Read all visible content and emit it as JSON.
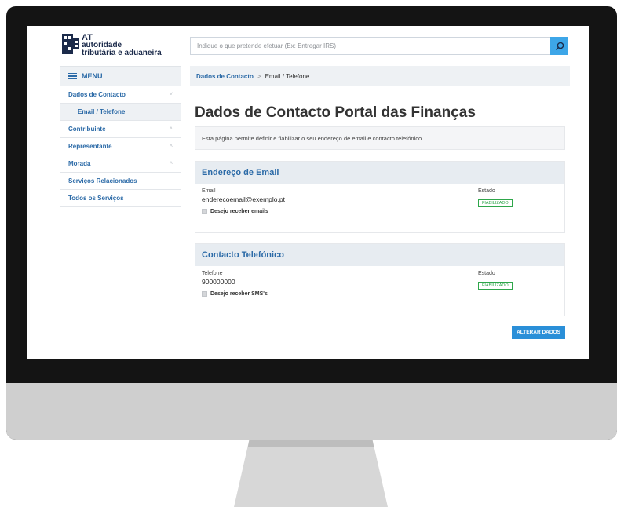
{
  "logo": {
    "line1": "AT",
    "line2": "autoridade",
    "line3": "tributária e aduaneira"
  },
  "search": {
    "placeholder": "Indique o que pretende efetuar (Ex: Entregar IRS)"
  },
  "sidebar": {
    "menu_label": "MENU",
    "items": [
      {
        "label": "Dados de Contacto",
        "chevron": "˅"
      },
      {
        "label": "Email / Telefone",
        "chevron": ""
      },
      {
        "label": "Contribuinte",
        "chevron": "˄"
      },
      {
        "label": "Representante",
        "chevron": "˄"
      },
      {
        "label": "Morada",
        "chevron": "˄"
      },
      {
        "label": "Serviços Relacionados",
        "chevron": ""
      },
      {
        "label": "Todos os Serviços",
        "chevron": ""
      }
    ]
  },
  "breadcrumb": {
    "parent": "Dados de Contacto",
    "separator": ">",
    "current": "Email / Telefone"
  },
  "page": {
    "title": "Dados de Contacto Portal das Finanças",
    "intro": "Esta página permite definir e fiabilizar o seu endereço de email e contacto telefónico."
  },
  "email_card": {
    "heading": "Endereço de Email",
    "field_label": "Email",
    "field_value": "enderecoemail@exemplo.pt",
    "checkbox_label": "Desejo receber emails",
    "status_label": "Estado",
    "status_badge": "FIABILIZADO"
  },
  "phone_card": {
    "heading": "Contacto Telefónico",
    "field_label": "Telefone",
    "field_value": "900000000",
    "checkbox_label": "Desejo receber SMS's",
    "status_label": "Estado",
    "status_badge": "FIABILIZADO"
  },
  "actions": {
    "alterar_label": "ALTERAR DADOS"
  },
  "colors": {
    "accent": "#2b6aa7",
    "button": "#2a8fd8",
    "badge": "#2ea64a",
    "search_button": "#3da6e8"
  }
}
